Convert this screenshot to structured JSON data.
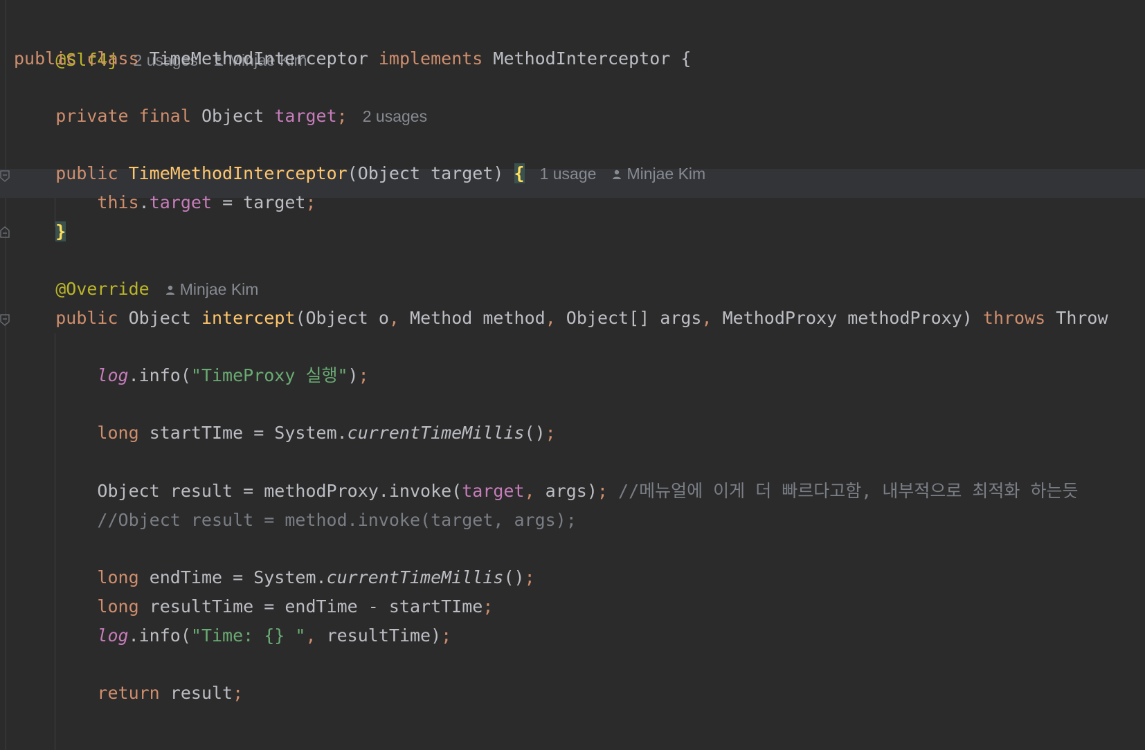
{
  "editor": {
    "lines": {
      "l1": {
        "annotation": "@Slf4j",
        "usages": "2 usages",
        "author": "Minjae Kim"
      },
      "l2": {
        "t1": "public",
        "t2": "class",
        "t3": "TimeMethodInterceptor",
        "t4": "implements",
        "t5": "MethodInterceptor",
        "t6": "{"
      },
      "l4": {
        "t1": "private",
        "t2": "final",
        "t3": "Object",
        "t4": "target",
        "t5": ";",
        "usages": "2 usages"
      },
      "l6": {
        "t1": "public",
        "t2": "TimeMethodInterceptor",
        "t3": "(Object target)",
        "t4": "{",
        "usages": "1 usage",
        "author": "Minjae Kim"
      },
      "l7": {
        "t1": "this",
        "t2": ".",
        "t3": "target",
        "t4": " = target",
        "t5": ";"
      },
      "l8": {
        "t1": "}"
      },
      "l10": {
        "annotation": "@Override",
        "author": "Minjae Kim"
      },
      "l11": {
        "t1": "public",
        "t2": "Object",
        "t3": "intercept",
        "t4": "(Object o",
        "t5": ",",
        "t6": " Method method",
        "t7": ",",
        "t8": " Object[] args",
        "t9": ",",
        "t10": " MethodProxy methodProxy)",
        "t11": "throws",
        "t12": "Throw"
      },
      "l13": {
        "t1": "log",
        "t2": ".info(",
        "t3": "\"TimeProxy 실행\"",
        "t4": ")",
        "t5": ";"
      },
      "l15": {
        "t1": "long",
        "t2": " startTIme = System.",
        "t3": "currentTimeMillis",
        "t4": "()",
        "t5": ";"
      },
      "l17": {
        "t1": "Object result = methodProxy.invoke(",
        "t2": "target",
        "t3": ",",
        "t4": " args)",
        "t5": ";",
        "t6": " //메뉴얼에 이게 더 빠르다고함, 내부적으로 최적화 하는듯"
      },
      "l18": {
        "t1": "//Object result = method.invoke(target, args);"
      },
      "l20": {
        "t1": "long",
        "t2": " endTime = System.",
        "t3": "currentTimeMillis",
        "t4": "()",
        "t5": ";"
      },
      "l21": {
        "t1": "long",
        "t2": " resultTime = endTime - startTIme",
        "t3": ";"
      },
      "l22": {
        "t1": "log",
        "t2": ".info(",
        "t3": "\"Time: {} \"",
        "t4": ",",
        "t5": " resultTime)",
        "t6": ";"
      },
      "l24": {
        "t1": "return",
        "t2": " result",
        "t3": ";"
      }
    },
    "colors": {
      "background": "#2b2b2b",
      "keyword": "#cf8e6d",
      "annotation": "#bbb529",
      "field": "#c77dbb",
      "string": "#6aab73",
      "comment": "#7a7e85",
      "method_decl": "#ffc66d",
      "brace_highlight": "#fede5d"
    },
    "icons": {
      "author": "person-icon",
      "fold": "fold-marker-icon"
    }
  }
}
